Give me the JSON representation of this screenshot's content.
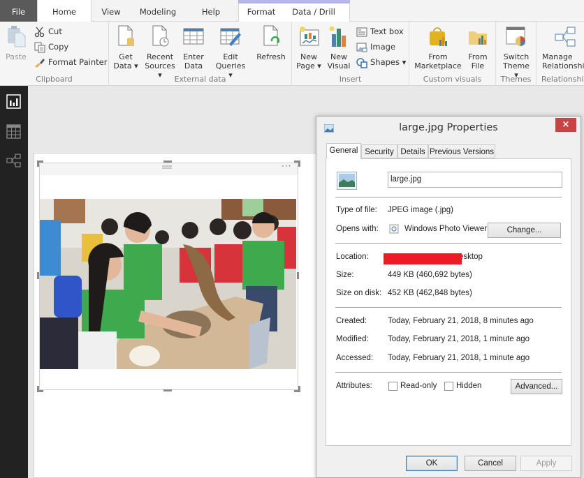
{
  "ribbon_tabs": {
    "file": "File",
    "home": "Home",
    "view": "View",
    "modeling": "Modeling",
    "help": "Help",
    "format": "Format",
    "data_drill": "Data / Drill"
  },
  "clipboard": {
    "label": "Clipboard",
    "paste": "Paste",
    "cut": "Cut",
    "copy": "Copy",
    "format_painter": "Format Painter"
  },
  "external_data": {
    "label": "External data",
    "get_data": "Get\nData ▾",
    "recent_sources": "Recent\nSources ▾",
    "enter_data": "Enter\nData",
    "edit_queries": "Edit\nQueries ▾",
    "refresh": "Refresh"
  },
  "insert": {
    "label": "Insert",
    "new_page": "New\nPage ▾",
    "new_visual": "New\nVisual",
    "text_box": "Text box",
    "image": "Image",
    "shapes": "Shapes ▾"
  },
  "custom_visuals": {
    "label": "Custom visuals",
    "from_marketplace": "From\nMarketplace",
    "from_file": "From\nFile"
  },
  "themes": {
    "label": "Themes",
    "switch_theme": "Switch\nTheme ▾"
  },
  "relationships": {
    "label": "Relationshi",
    "manage": "Manage\nRelationshi"
  },
  "visual": {
    "more_options": "···"
  },
  "dialog": {
    "title": "large.jpg Properties",
    "close": "×",
    "tabs": [
      "General",
      "Security",
      "Details",
      "Previous Versions"
    ],
    "filename": "large.jpg",
    "type_label": "Type of file:",
    "type_value": "JPEG image (.jpg)",
    "opens_label": "Opens with:",
    "opens_value": "Windows Photo Viewer",
    "change_button": "Change...",
    "location_label": "Location:",
    "location_value_visible": "esktop",
    "size_label": "Size:",
    "size_value": "449 KB (460,692 bytes)",
    "disk_label": "Size on disk:",
    "disk_value": "452 KB (462,848 bytes)",
    "created_label": "Created:",
    "created_value": "Today, February 21, 2018, 8 minutes ago",
    "modified_label": "Modified:",
    "modified_value": "Today, February 21, 2018, 1 minute ago",
    "accessed_label": "Accessed:",
    "accessed_value": "Today, February 21, 2018, 1 minute ago",
    "attributes_label": "Attributes:",
    "readonly_label": "Read-only",
    "readonly_checked": false,
    "hidden_label": "Hidden",
    "hidden_checked": false,
    "advanced_button": "Advanced...",
    "ok_button": "OK",
    "cancel_button": "Cancel",
    "apply_button": "Apply"
  },
  "colors": {
    "close_red": "#c84343",
    "redaction": "#ed1c24",
    "context_tab": "#b7b5e8",
    "nav_bg": "#222222"
  }
}
